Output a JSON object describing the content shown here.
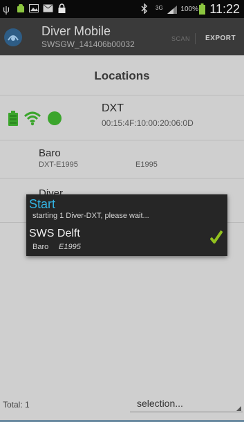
{
  "statusbar": {
    "time": "11:22",
    "battery_pct": "100%",
    "network": "3G"
  },
  "appbar": {
    "title": "Diver Mobile",
    "subtitle": "SWSGW_141406b00032",
    "scan_label": "SCAN",
    "export_label": "EXPORT"
  },
  "locations": {
    "title": "Locations",
    "dxt": {
      "name": "DXT",
      "mac": "00:15:4F:10:00:20:06:0D"
    },
    "baro": {
      "name": "Baro",
      "id": "DXT-E1995",
      "serial": "E1995"
    },
    "diver": {
      "name": "Diver"
    }
  },
  "dialog": {
    "title": "Start",
    "message": "starting 1 Diver-DXT, please wait...",
    "location": "SWS Delft",
    "sensor": "Baro",
    "serial": "E1995"
  },
  "footer": {
    "total": "Total: 1",
    "selection": "selection..."
  },
  "colors": {
    "accent": "#33b5e5",
    "status_green": "#3ba52c",
    "check_green": "#92c11e"
  }
}
